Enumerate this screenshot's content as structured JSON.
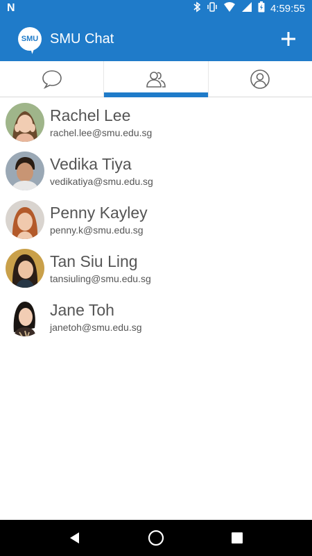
{
  "status_bar": {
    "time": "4:59:55",
    "icons": [
      "n-icon",
      "bluetooth-icon",
      "vibrate-icon",
      "wifi-icon",
      "signal-icon",
      "battery-charging-icon"
    ]
  },
  "app_bar": {
    "logo_text": "SMU",
    "title": "SMU Chat",
    "action_icon": "plus-icon"
  },
  "tabs": [
    {
      "icon": "chat-bubble-icon",
      "active": false
    },
    {
      "icon": "contacts-icon",
      "active": true
    },
    {
      "icon": "profile-icon",
      "active": false
    }
  ],
  "contacts": [
    {
      "name": "Rachel Lee",
      "email": "rachel.lee@smu.edu.sg"
    },
    {
      "name": "Vedika Tiya",
      "email": "vedikatiya@smu.edu.sg"
    },
    {
      "name": "Penny Kayley",
      "email": "penny.k@smu.edu.sg"
    },
    {
      "name": "Tan Siu Ling",
      "email": "tansiuling@smu.edu.sg"
    },
    {
      "name": "Jane Toh",
      "email": "janetoh@smu.edu.sg"
    }
  ],
  "nav_bar": [
    "back-icon",
    "home-icon",
    "recents-icon"
  ],
  "colors": {
    "primary": "#1f7bc9",
    "text": "#555555",
    "divider": "#d9d9d9"
  }
}
